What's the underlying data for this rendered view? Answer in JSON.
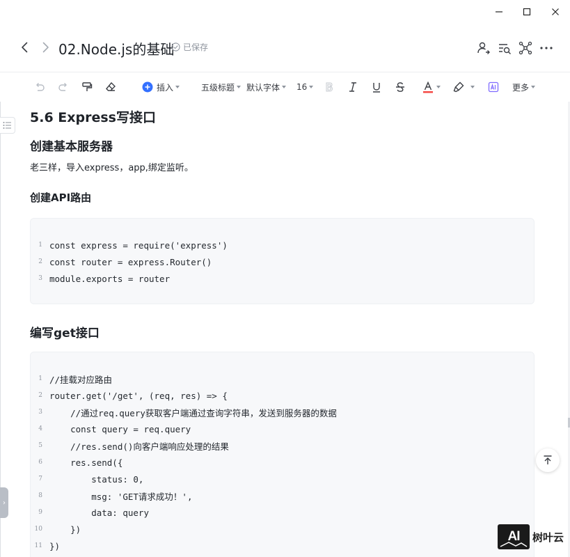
{
  "window": {
    "minimize_icon": "minimize-icon",
    "maximize_icon": "maximize-icon",
    "close_icon": "close-icon"
  },
  "header": {
    "title": "02.Node.js的基础",
    "saved_status": "已保存",
    "icons": [
      "share-user-icon",
      "find-replace-icon",
      "mind-map-icon",
      "more-icon"
    ]
  },
  "toolbar": {
    "insert_label": "插入",
    "heading_label": "五级标题",
    "font_label": "默认字体",
    "size_label": "16",
    "more_label": "更多",
    "text_color_label": "A",
    "accent_color": "#3370ff",
    "text_color_bar": "#f54a45"
  },
  "doc": {
    "h_express": "5.6 Express写接口",
    "h_server": "创建基本服务器",
    "p_server": "老三样，导入express，app,绑定监听。",
    "h_router": "创建API路由",
    "code1": [
      "const express = require('express')",
      "const router = express.Router()",
      "module.exports = router"
    ],
    "h_get": "编写get接口",
    "code2": [
      "//挂载对应路由",
      "router.get('/get', (req, res) => {",
      "    //通过req.query获取客户端通过查询字符串，发送到服务器的数据",
      "    const query = req.query",
      "    //res.send()向客户端响应处理的结果",
      "    res.send({",
      "        status: 0,",
      "        msg: 'GET请求成功！',",
      "        data: query",
      "    })",
      "})"
    ]
  },
  "line_numbers": {
    "code1": [
      "1",
      "2",
      "3"
    ],
    "code2": [
      "1",
      "2",
      "3",
      "4",
      "5",
      "6",
      "7",
      "8",
      "9",
      "10",
      "11"
    ]
  },
  "watermark": {
    "logo": "AI",
    "text": "树叶云"
  }
}
